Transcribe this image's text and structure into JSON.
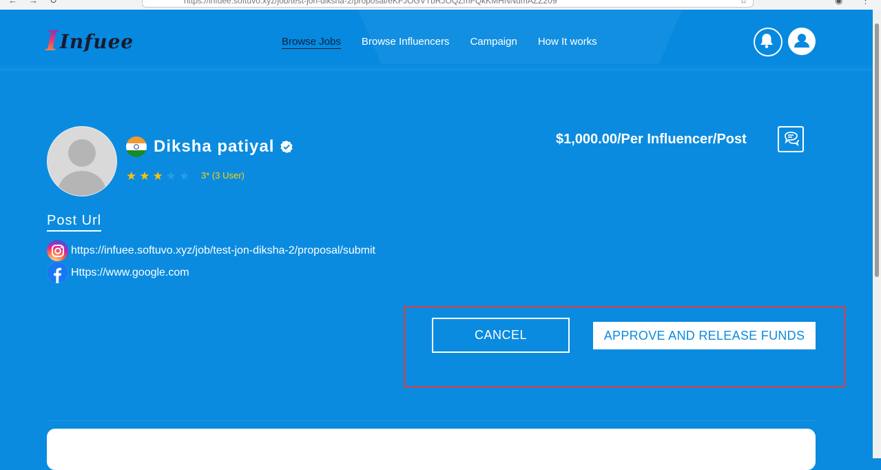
{
  "browser": {
    "url": "https://infuee.softuvo.xyz/job/test-jon-diksha-2/proposal/eKFJOGVTbRJOQZmFQkKMHNNumAZZ209"
  },
  "header": {
    "logo_mark": "I",
    "logo_text": "Infuee",
    "nav": [
      {
        "label": "Browse Jobs",
        "active": true
      },
      {
        "label": "Browse Influencers"
      },
      {
        "label": "Campaign"
      },
      {
        "label": "How It works"
      }
    ]
  },
  "profile": {
    "name": "Diksha patiyal",
    "country": "India",
    "rating": 3,
    "rating_max": 5,
    "rating_text": "3* (3 User)",
    "price": "$1,000.00/Per Influencer/Post"
  },
  "post_url": {
    "heading": "Post Url",
    "links": [
      {
        "platform": "instagram",
        "icon": "instagram-icon",
        "url": "https://infuee.softuvo.xyz/job/test-jon-diksha-2/proposal/submit"
      },
      {
        "platform": "facebook",
        "icon": "facebook-icon",
        "url": "Https://www.google.com"
      }
    ]
  },
  "actions": {
    "cancel_label": "CANCEL",
    "approve_label": "APPROVE AND RELEASE FUNDS"
  },
  "colors": {
    "background": "#0a8be0",
    "star_filled": "#ffc107",
    "rating_text": "#ffd400",
    "highlight_border": "#e53935"
  }
}
